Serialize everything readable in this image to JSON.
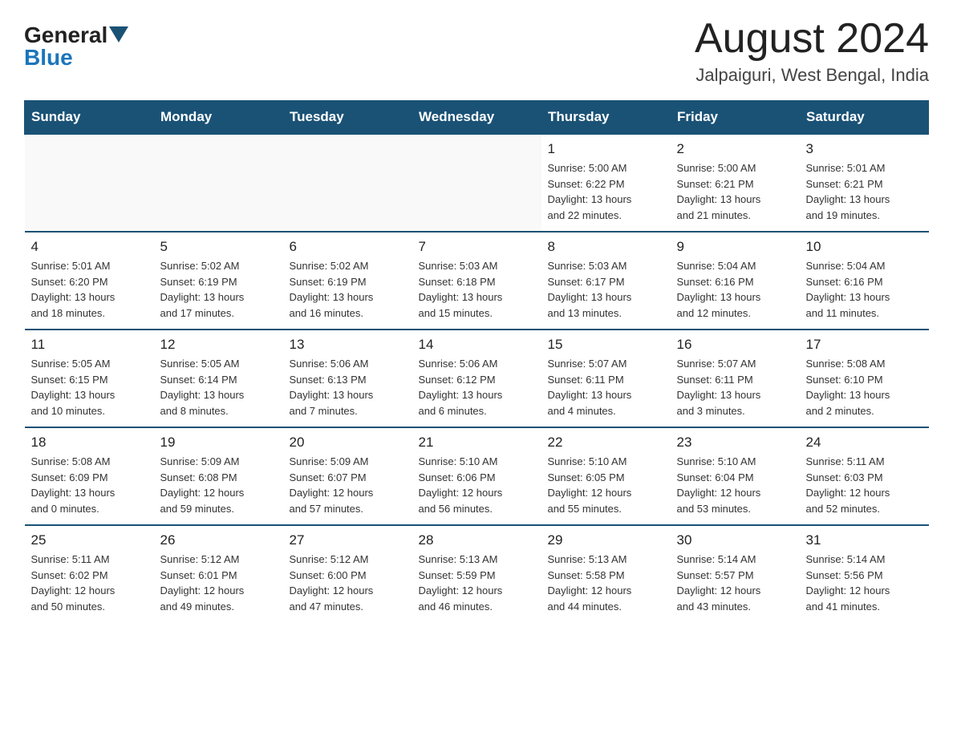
{
  "logo": {
    "general": "General",
    "blue": "Blue"
  },
  "header": {
    "title": "August 2024",
    "subtitle": "Jalpaiguri, West Bengal, India"
  },
  "weekdays": [
    "Sunday",
    "Monday",
    "Tuesday",
    "Wednesday",
    "Thursday",
    "Friday",
    "Saturday"
  ],
  "weeks": [
    [
      {
        "day": "",
        "info": ""
      },
      {
        "day": "",
        "info": ""
      },
      {
        "day": "",
        "info": ""
      },
      {
        "day": "",
        "info": ""
      },
      {
        "day": "1",
        "info": "Sunrise: 5:00 AM\nSunset: 6:22 PM\nDaylight: 13 hours\nand 22 minutes."
      },
      {
        "day": "2",
        "info": "Sunrise: 5:00 AM\nSunset: 6:21 PM\nDaylight: 13 hours\nand 21 minutes."
      },
      {
        "day": "3",
        "info": "Sunrise: 5:01 AM\nSunset: 6:21 PM\nDaylight: 13 hours\nand 19 minutes."
      }
    ],
    [
      {
        "day": "4",
        "info": "Sunrise: 5:01 AM\nSunset: 6:20 PM\nDaylight: 13 hours\nand 18 minutes."
      },
      {
        "day": "5",
        "info": "Sunrise: 5:02 AM\nSunset: 6:19 PM\nDaylight: 13 hours\nand 17 minutes."
      },
      {
        "day": "6",
        "info": "Sunrise: 5:02 AM\nSunset: 6:19 PM\nDaylight: 13 hours\nand 16 minutes."
      },
      {
        "day": "7",
        "info": "Sunrise: 5:03 AM\nSunset: 6:18 PM\nDaylight: 13 hours\nand 15 minutes."
      },
      {
        "day": "8",
        "info": "Sunrise: 5:03 AM\nSunset: 6:17 PM\nDaylight: 13 hours\nand 13 minutes."
      },
      {
        "day": "9",
        "info": "Sunrise: 5:04 AM\nSunset: 6:16 PM\nDaylight: 13 hours\nand 12 minutes."
      },
      {
        "day": "10",
        "info": "Sunrise: 5:04 AM\nSunset: 6:16 PM\nDaylight: 13 hours\nand 11 minutes."
      }
    ],
    [
      {
        "day": "11",
        "info": "Sunrise: 5:05 AM\nSunset: 6:15 PM\nDaylight: 13 hours\nand 10 minutes."
      },
      {
        "day": "12",
        "info": "Sunrise: 5:05 AM\nSunset: 6:14 PM\nDaylight: 13 hours\nand 8 minutes."
      },
      {
        "day": "13",
        "info": "Sunrise: 5:06 AM\nSunset: 6:13 PM\nDaylight: 13 hours\nand 7 minutes."
      },
      {
        "day": "14",
        "info": "Sunrise: 5:06 AM\nSunset: 6:12 PM\nDaylight: 13 hours\nand 6 minutes."
      },
      {
        "day": "15",
        "info": "Sunrise: 5:07 AM\nSunset: 6:11 PM\nDaylight: 13 hours\nand 4 minutes."
      },
      {
        "day": "16",
        "info": "Sunrise: 5:07 AM\nSunset: 6:11 PM\nDaylight: 13 hours\nand 3 minutes."
      },
      {
        "day": "17",
        "info": "Sunrise: 5:08 AM\nSunset: 6:10 PM\nDaylight: 13 hours\nand 2 minutes."
      }
    ],
    [
      {
        "day": "18",
        "info": "Sunrise: 5:08 AM\nSunset: 6:09 PM\nDaylight: 13 hours\nand 0 minutes."
      },
      {
        "day": "19",
        "info": "Sunrise: 5:09 AM\nSunset: 6:08 PM\nDaylight: 12 hours\nand 59 minutes."
      },
      {
        "day": "20",
        "info": "Sunrise: 5:09 AM\nSunset: 6:07 PM\nDaylight: 12 hours\nand 57 minutes."
      },
      {
        "day": "21",
        "info": "Sunrise: 5:10 AM\nSunset: 6:06 PM\nDaylight: 12 hours\nand 56 minutes."
      },
      {
        "day": "22",
        "info": "Sunrise: 5:10 AM\nSunset: 6:05 PM\nDaylight: 12 hours\nand 55 minutes."
      },
      {
        "day": "23",
        "info": "Sunrise: 5:10 AM\nSunset: 6:04 PM\nDaylight: 12 hours\nand 53 minutes."
      },
      {
        "day": "24",
        "info": "Sunrise: 5:11 AM\nSunset: 6:03 PM\nDaylight: 12 hours\nand 52 minutes."
      }
    ],
    [
      {
        "day": "25",
        "info": "Sunrise: 5:11 AM\nSunset: 6:02 PM\nDaylight: 12 hours\nand 50 minutes."
      },
      {
        "day": "26",
        "info": "Sunrise: 5:12 AM\nSunset: 6:01 PM\nDaylight: 12 hours\nand 49 minutes."
      },
      {
        "day": "27",
        "info": "Sunrise: 5:12 AM\nSunset: 6:00 PM\nDaylight: 12 hours\nand 47 minutes."
      },
      {
        "day": "28",
        "info": "Sunrise: 5:13 AM\nSunset: 5:59 PM\nDaylight: 12 hours\nand 46 minutes."
      },
      {
        "day": "29",
        "info": "Sunrise: 5:13 AM\nSunset: 5:58 PM\nDaylight: 12 hours\nand 44 minutes."
      },
      {
        "day": "30",
        "info": "Sunrise: 5:14 AM\nSunset: 5:57 PM\nDaylight: 12 hours\nand 43 minutes."
      },
      {
        "day": "31",
        "info": "Sunrise: 5:14 AM\nSunset: 5:56 PM\nDaylight: 12 hours\nand 41 minutes."
      }
    ]
  ]
}
